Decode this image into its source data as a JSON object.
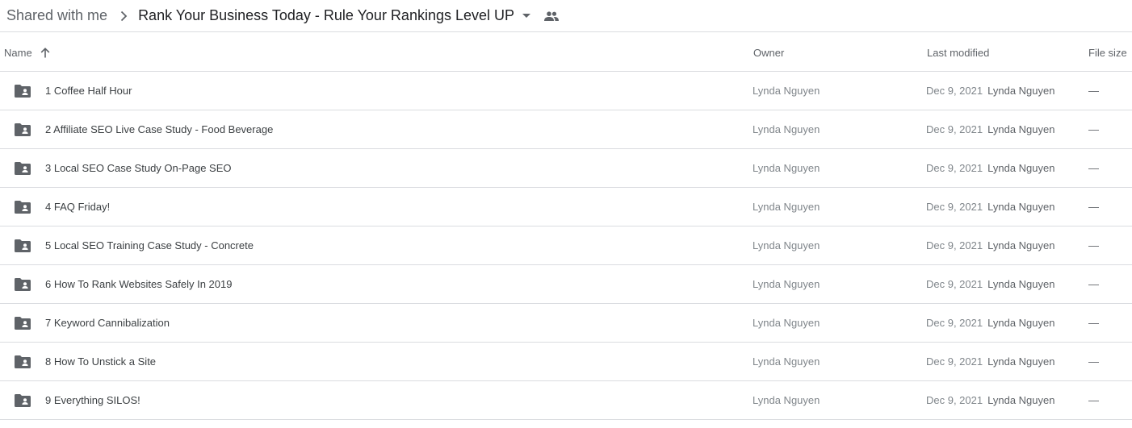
{
  "breadcrumb": {
    "root_label": "Shared with me",
    "separator_icon": "chevron-right-icon",
    "current_folder": "Rank Your Business Today - Rule Your Rankings Level UP",
    "dropdown_icon": "caret-down-icon",
    "shared_icon": "people-icon"
  },
  "columns": {
    "name": "Name",
    "owner": "Owner",
    "last_modified": "Last modified",
    "file_size": "File size",
    "sort_icon": "arrow-up-icon"
  },
  "colors": {
    "folder_icon": "#5f6368",
    "divider": "#dadce0",
    "primary_text": "#202124",
    "secondary_text": "#80868b"
  },
  "rows": [
    {
      "icon": "shared-folder-icon",
      "name": "1 Coffee Half Hour",
      "owner": "Lynda Nguyen",
      "modified_date": "Dec 9, 2021",
      "modified_by": "Lynda Nguyen",
      "size": "—"
    },
    {
      "icon": "shared-folder-icon",
      "name": "2 Affiliate SEO Live Case Study - Food Beverage",
      "owner": "Lynda Nguyen",
      "modified_date": "Dec 9, 2021",
      "modified_by": "Lynda Nguyen",
      "size": "—"
    },
    {
      "icon": "shared-folder-icon",
      "name": "3 Local SEO Case Study On-Page SEO",
      "owner": "Lynda Nguyen",
      "modified_date": "Dec 9, 2021",
      "modified_by": "Lynda Nguyen",
      "size": "—"
    },
    {
      "icon": "shared-folder-icon",
      "name": "4 FAQ Friday!",
      "owner": "Lynda Nguyen",
      "modified_date": "Dec 9, 2021",
      "modified_by": "Lynda Nguyen",
      "size": "—"
    },
    {
      "icon": "shared-folder-icon",
      "name": "5 Local SEO Training Case Study - Concrete",
      "owner": "Lynda Nguyen",
      "modified_date": "Dec 9, 2021",
      "modified_by": "Lynda Nguyen",
      "size": "—"
    },
    {
      "icon": "shared-folder-icon",
      "name": "6 How To Rank Websites Safely In 2019",
      "owner": "Lynda Nguyen",
      "modified_date": "Dec 9, 2021",
      "modified_by": "Lynda Nguyen",
      "size": "—"
    },
    {
      "icon": "shared-folder-icon",
      "name": "7 Keyword Cannibalization",
      "owner": "Lynda Nguyen",
      "modified_date": "Dec 9, 2021",
      "modified_by": "Lynda Nguyen",
      "size": "—"
    },
    {
      "icon": "shared-folder-icon",
      "name": "8 How To Unstick a Site",
      "owner": "Lynda Nguyen",
      "modified_date": "Dec 9, 2021",
      "modified_by": "Lynda Nguyen",
      "size": "—"
    },
    {
      "icon": "shared-folder-icon",
      "name": "9 Everything SILOS!",
      "owner": "Lynda Nguyen",
      "modified_date": "Dec 9, 2021",
      "modified_by": "Lynda Nguyen",
      "size": "—"
    }
  ]
}
